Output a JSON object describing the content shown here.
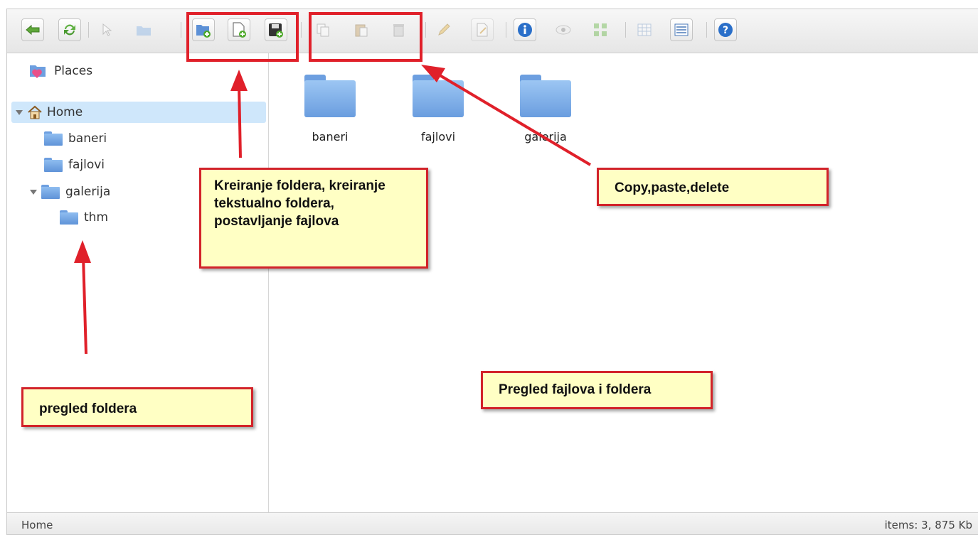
{
  "toolbar": {
    "buttons": [
      {
        "name": "back-button",
        "icon": "arrow-left-icon",
        "enabled": true
      },
      {
        "name": "reload-button",
        "icon": "refresh-icon",
        "enabled": true
      },
      {
        "name": "select-button",
        "icon": "cursor-icon",
        "enabled": false
      },
      {
        "name": "open-button",
        "icon": "folder-icon",
        "enabled": false
      },
      {
        "name": "new-folder-button",
        "icon": "new-folder-icon",
        "enabled": true
      },
      {
        "name": "new-file-button",
        "icon": "new-file-icon",
        "enabled": true
      },
      {
        "name": "upload-button",
        "icon": "save-upload-icon",
        "enabled": true
      },
      {
        "name": "copy-button",
        "icon": "copy-icon",
        "enabled": false
      },
      {
        "name": "paste-button",
        "icon": "paste-icon",
        "enabled": false
      },
      {
        "name": "delete-button",
        "icon": "delete-icon",
        "enabled": false
      },
      {
        "name": "rename-button",
        "icon": "pencil-icon",
        "enabled": false
      },
      {
        "name": "edit-button",
        "icon": "edit-document-icon",
        "enabled": false
      },
      {
        "name": "info-button",
        "icon": "info-icon",
        "enabled": true
      },
      {
        "name": "preview-button",
        "icon": "eye-icon",
        "enabled": false
      },
      {
        "name": "icons-view-button",
        "icon": "grid-view-icon",
        "enabled": false
      },
      {
        "name": "list-view-button",
        "icon": "table-view-icon",
        "enabled": false
      },
      {
        "name": "details-view-button",
        "icon": "list-view-icon",
        "enabled": true
      },
      {
        "name": "help-button",
        "icon": "help-icon",
        "enabled": true
      }
    ]
  },
  "sidebar": {
    "places_label": "Places",
    "home_label": "Home",
    "items": [
      {
        "label": "baneri"
      },
      {
        "label": "fajlovi"
      },
      {
        "label": "galerija"
      },
      {
        "label": "thm"
      }
    ]
  },
  "main": {
    "files": [
      {
        "label": "baneri"
      },
      {
        "label": "fajlovi"
      },
      {
        "label": "galerija"
      }
    ]
  },
  "statusbar": {
    "path": "Home",
    "info": "items: 3, 875 Kb"
  },
  "annotations": {
    "create_note": "Kreiranje foldera, kreiranje tekstualno foldera, postavljanje fajlova",
    "copy_note": "Copy,paste,delete",
    "tree_note": "pregled foldera",
    "main_note": "Pregled fajlova i foldera",
    "color": "#e0202a"
  }
}
